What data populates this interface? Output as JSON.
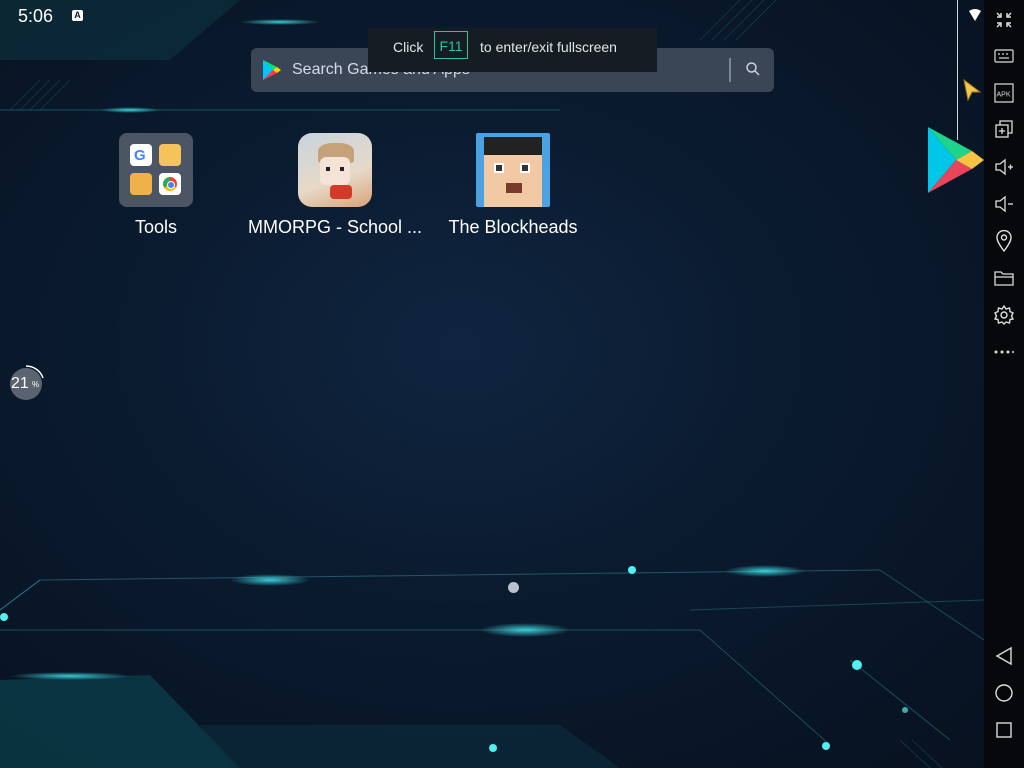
{
  "status_bar": {
    "time": "5:06",
    "input_badge": "A"
  },
  "search": {
    "placeholder": "Search Games and Apps"
  },
  "fullscreen_hint": {
    "prefix": "Click",
    "key": "F11",
    "suffix": "to enter/exit fullscreen"
  },
  "apps": [
    {
      "label": "Tools",
      "icon": "tools-folder-icon"
    },
    {
      "label": "MMORPG - School ...",
      "icon": "mmorpg-school-app-icon"
    },
    {
      "label": "The Blockheads",
      "icon": "blockheads-app-icon"
    }
  ],
  "loading": {
    "percent": "21",
    "unit": "%"
  },
  "sidebar": {
    "items": [
      {
        "name": "fullscreen-exit-icon"
      },
      {
        "name": "keyboard-icon"
      },
      {
        "name": "apk-install-icon"
      },
      {
        "name": "multi-instance-icon"
      },
      {
        "name": "volume-up-icon"
      },
      {
        "name": "volume-down-icon"
      },
      {
        "name": "location-icon"
      },
      {
        "name": "folder-icon"
      },
      {
        "name": "settings-gear-icon"
      },
      {
        "name": "more-options-icon"
      }
    ],
    "nav": [
      {
        "name": "back-icon"
      },
      {
        "name": "home-icon"
      },
      {
        "name": "recents-icon"
      }
    ],
    "apk_label": "APK"
  },
  "colors": {
    "accent": "#27c4a8",
    "background": "#0a1a2e",
    "sidebar": "#06080c",
    "search_bg": "#3a4656"
  }
}
